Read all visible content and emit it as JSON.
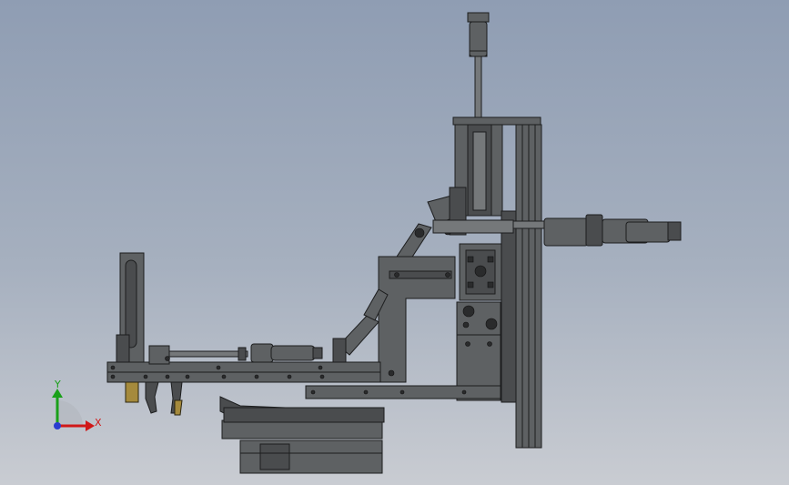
{
  "triad": {
    "y_label": "Y",
    "x_label": "X",
    "y_color": "#1aa01a",
    "x_color": "#d01818",
    "z_color": "#2a3cd0"
  },
  "colors": {
    "background_top": "#8f9db3",
    "background_bottom": "#c9ccd2",
    "steel": "#5e6163",
    "brass": "#a58a3c"
  }
}
